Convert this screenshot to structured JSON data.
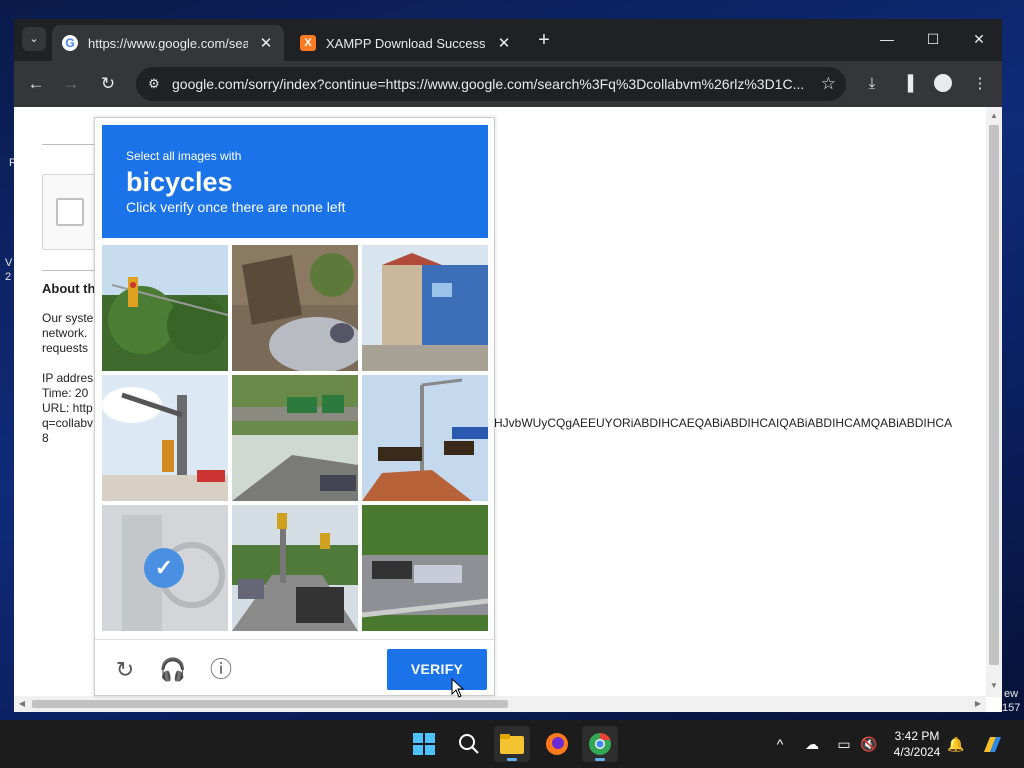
{
  "browser": {
    "tabs": [
      {
        "title": "https://www.google.com/searc",
        "favicon": "google-favicon",
        "active": true
      },
      {
        "title": "XAMPP Download Success",
        "favicon": "xampp-favicon",
        "active": false
      }
    ],
    "address": "google.com/sorry/index?continue=https://www.google.com/search%3Fq%3Dcollabvm%26rlz%3D1C..."
  },
  "page": {
    "about_heading": "About th",
    "body_lines": [
      "Our syste",
      "network.",
      "requests"
    ],
    "ip_label": "IP addres",
    "time_label": "Time: 20",
    "url_label": "URL: http",
    "q_fragment": "q=collabv",
    "eight": "8",
    "long_token": "HJvbWUyCQgAEEUYORiABDIHCAEQABiABDIHCAIQABiABDIHCAMQABiABDIHCA"
  },
  "captcha": {
    "instruction": "Select all images with",
    "target": "bicycles",
    "subtext": "Click verify once there are none left",
    "verify_label": "VERIFY",
    "tiles": [
      {
        "name": "tile-traffic-light-trees",
        "selected": false
      },
      {
        "name": "tile-junk-pile-car",
        "selected": false
      },
      {
        "name": "tile-street-building",
        "selected": false
      },
      {
        "name": "tile-traffic-signal-pole",
        "selected": false
      },
      {
        "name": "tile-highway-overpass-sign",
        "selected": false
      },
      {
        "name": "tile-signals-street-sign",
        "selected": false
      },
      {
        "name": "tile-selected-bicycle",
        "selected": true
      },
      {
        "name": "tile-road-traffic-cars",
        "selected": false
      },
      {
        "name": "tile-highway-cars",
        "selected": false
      }
    ]
  },
  "desktop": {
    "frag_r": "R",
    "frag_v": "V",
    "frag_20": "2",
    "frag_ew": "ew",
    "frag_157": "157"
  },
  "taskbar": {
    "time": "3:42 PM",
    "date": "4/3/2024"
  },
  "colors": {
    "captcha_blue": "#1a73e8",
    "chrome_dark": "#202124",
    "chrome_toolbar": "#35363a"
  }
}
